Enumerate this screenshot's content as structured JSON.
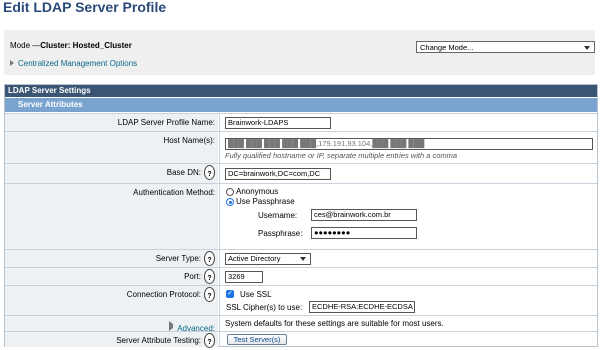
{
  "page": {
    "title": "Edit LDAP Server Profile"
  },
  "mode": {
    "label": "Mode —",
    "cluster_label": "Cluster: Hosted_Cluster",
    "change_mode_value": "Change Mode...",
    "cmo_link": "Centralized Management Options"
  },
  "panel": {
    "header": "LDAP Server Settings",
    "subheader": "Server Attributes"
  },
  "fields": {
    "profile_name": {
      "label": "LDAP Server Profile Name:",
      "value": "Brainwork-LDAPS"
    },
    "host_names": {
      "label": "Host Name(s):",
      "value": "███ ███ ███ ███ ███,179.191.93.104,███ ███ ███",
      "hint": "Fully qualified hostname or IP, separate multiple entries with a comma"
    },
    "base_dn": {
      "label": "Base DN:",
      "value": "DC=brainwork,DC=com,DC"
    },
    "auth_method": {
      "label": "Authentication Method:",
      "option_anonymous": "Anonymous",
      "option_passphrase": "Use Passphrase",
      "selected": "Use Passphrase",
      "username_label": "Username:",
      "username_value": "ces@brainwork.com.br",
      "passphrase_label": "Passphrase:",
      "passphrase_value": "●●●●●●●●"
    },
    "server_type": {
      "label": "Server Type:",
      "value": "Active Directory"
    },
    "port": {
      "label": "Port:",
      "value": "3269"
    },
    "connection_protocol": {
      "label": "Connection Protocol:",
      "use_ssl": "Use SSL",
      "use_ssl_checked": true,
      "cipher_label": "SSL Cipher(s) to use:",
      "cipher_value": "ECDHE-RSA:ECDHE-ECDSA"
    },
    "advanced": {
      "label": "Advanced:",
      "text": "System defaults for these settings are suitable for most users."
    },
    "attribute_testing": {
      "label": "Server Attribute Testing:",
      "button": "Test Server(s)"
    }
  },
  "help_glyph": "?",
  "check_glyph": "✓"
}
